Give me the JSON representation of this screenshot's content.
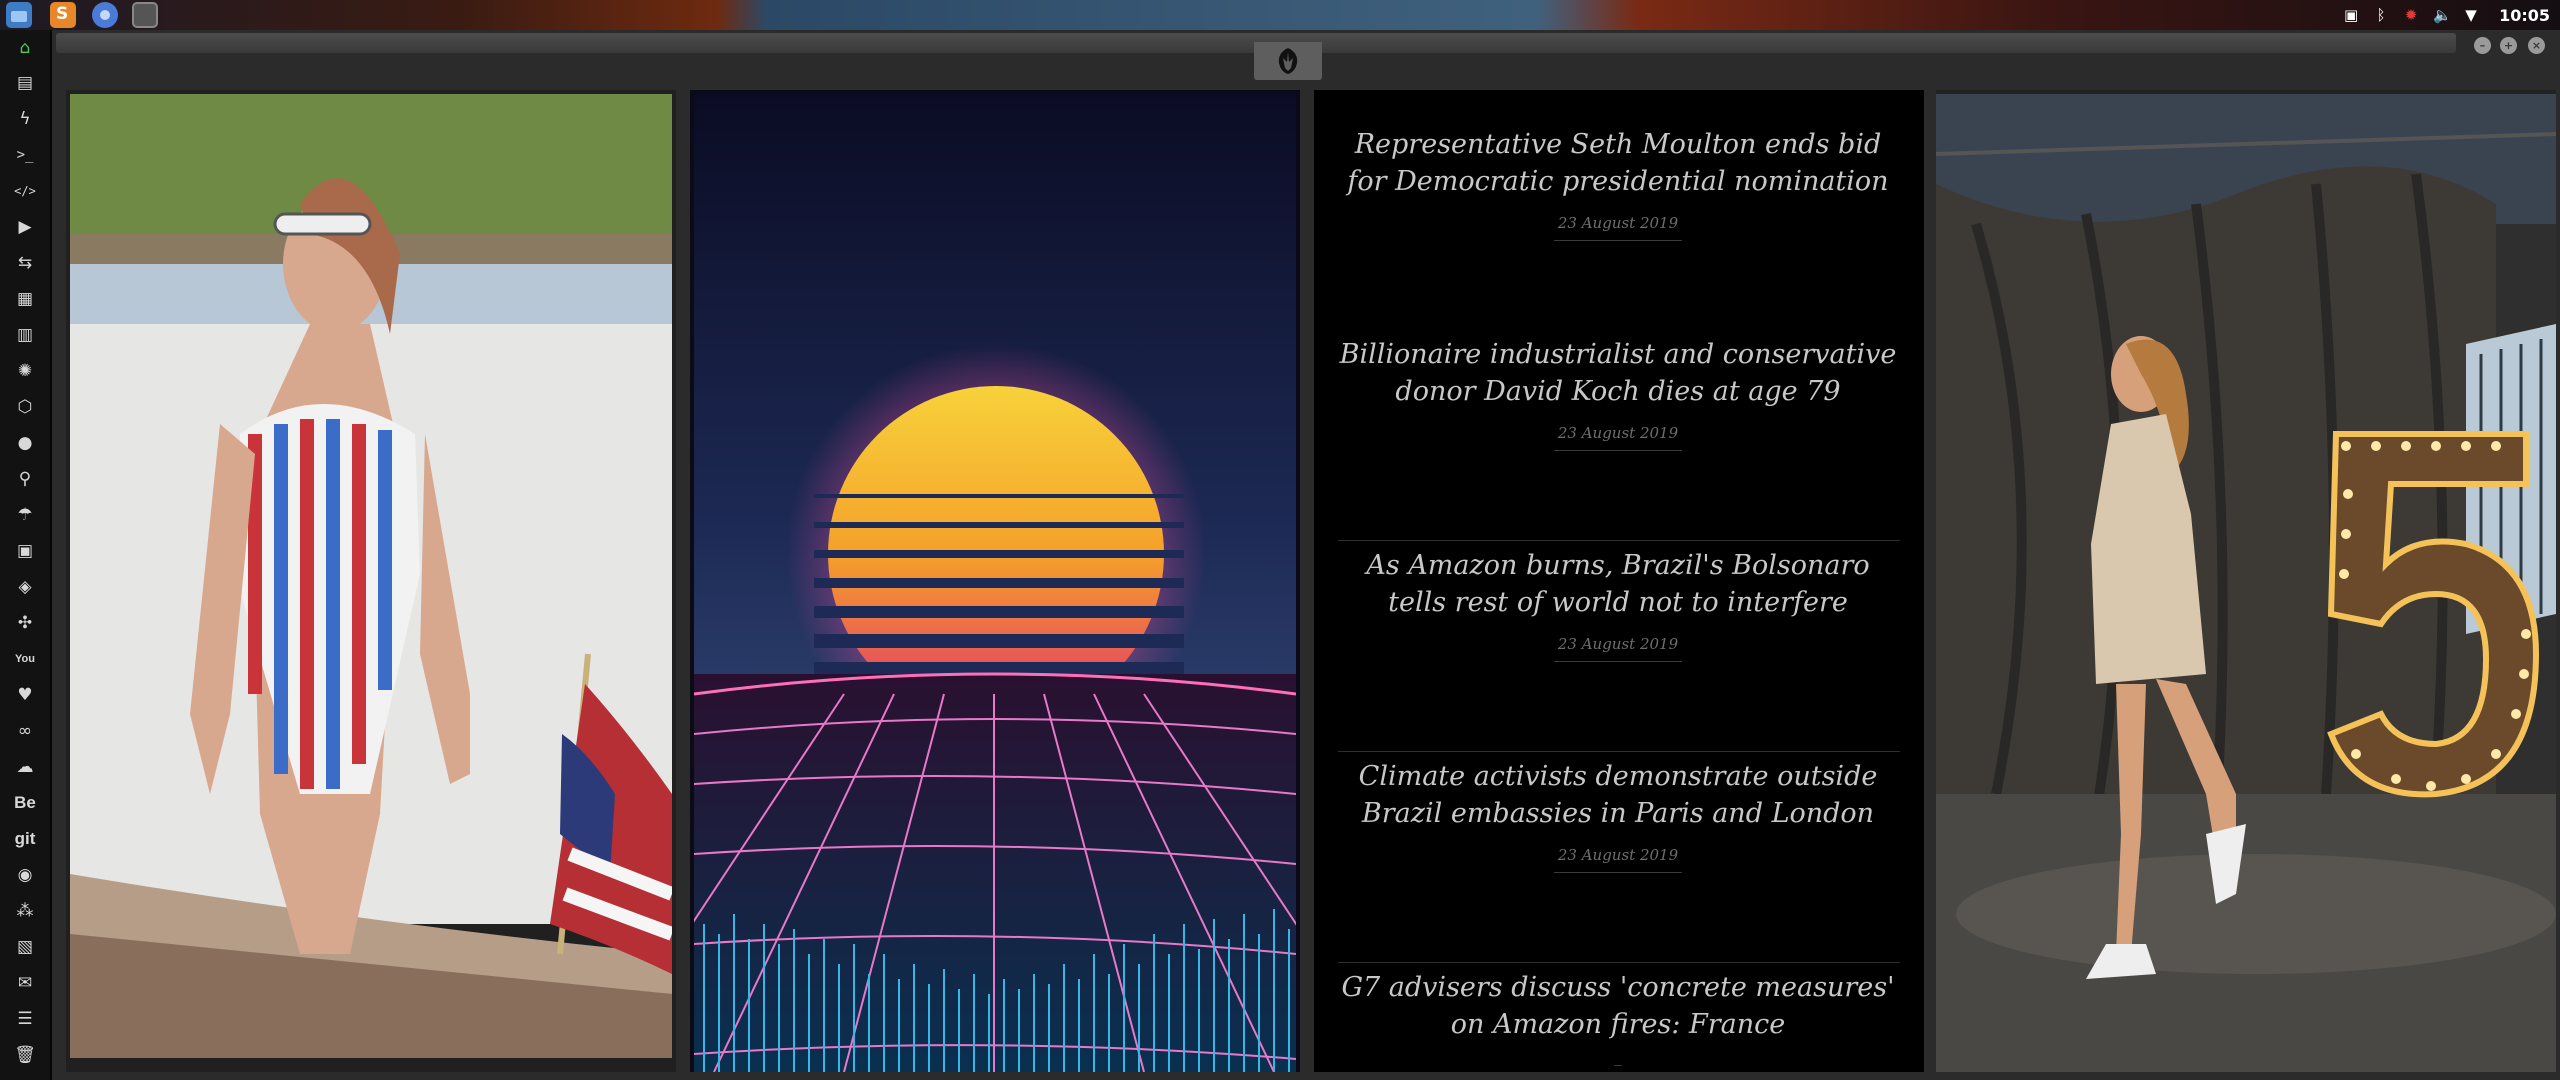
{
  "system_bar": {
    "clock": "10:05",
    "apps": [
      "files-icon",
      "sublime-text-icon",
      "chrome-icon",
      "terminal-icon"
    ],
    "tray": [
      "screenshot-icon",
      "bluetooth-icon",
      "notification-icon",
      "volume-icon",
      "wifi-icon"
    ]
  },
  "dock": {
    "items": [
      "home-icon",
      "document-icon",
      "bolt-icon",
      "terminal-icon",
      "code-icon",
      "play-icon",
      "translate-icon",
      "image-icon",
      "news-icon",
      "aperture-icon",
      "hexagon-icon",
      "globe-icon",
      "search-icon",
      "umbrella-icon",
      "contact-icon",
      "tag-icon",
      "fullscreen-icon",
      "youtube-icon",
      "heart-icon",
      "infinity-icon",
      "cloud-icon",
      "behance-icon",
      "git-icon",
      "github-icon",
      "connections-icon",
      "map-icon",
      "mail-icon",
      "server-icon",
      "trash-icon"
    ],
    "behance_label": "Be",
    "git_label": "git",
    "youtube_label": "You"
  },
  "news": [
    {
      "headline": "Representative Seth Moulton ends bid for Democratic presidential nomination",
      "date": "23 August 2019"
    },
    {
      "headline": "Billionaire industrialist and conservative donor David Koch dies at age 79",
      "date": "23 August 2019"
    },
    {
      "headline": "As Amazon burns, Brazil's Bolsonaro tells rest of world not to interfere",
      "date": "23 August 2019"
    },
    {
      "headline": "Climate activists demonstrate outside Brazil embassies in Paris and London",
      "date": "23 August 2019"
    },
    {
      "headline": "G7 advisers discuss 'concrete measures' on Amazon fires: France",
      "date": ""
    }
  ],
  "colors": {
    "accent_active": "#4ec95a",
    "background": "#050505",
    "headline": "#c8c8c8",
    "date": "#6e6e6e"
  }
}
